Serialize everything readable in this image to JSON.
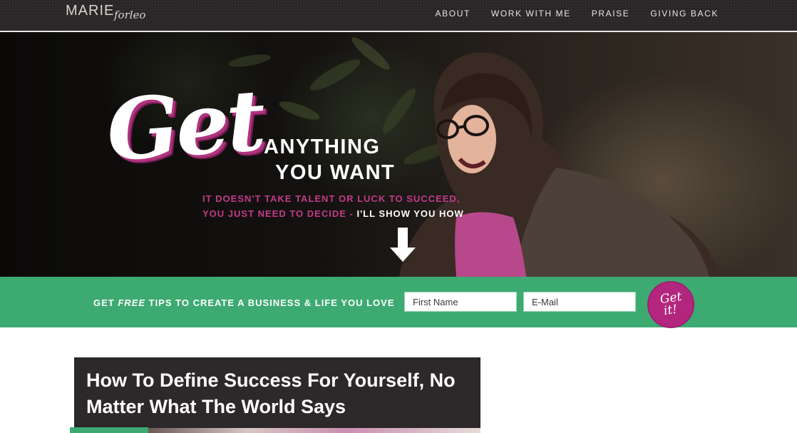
{
  "header": {
    "logo_main": "MARIE",
    "logo_script": "forleo",
    "nav": [
      "ABOUT",
      "WORK WITH ME",
      "PRAISE",
      "GIVING BACK"
    ]
  },
  "hero": {
    "script_word": "Get",
    "line1": "ANYTHING",
    "line2": "YOU WANT",
    "sub1": "IT DOESN'T TAKE TALENT OR LUCK TO SUCCEED,",
    "sub2_pink": "YOU JUST NEED TO DECIDE - ",
    "sub2_white": "I'LL SHOW YOU HOW",
    "arrow_icon": "down-arrow-icon"
  },
  "signup": {
    "text_before": "GET ",
    "text_em": "FREE",
    "text_after": " TIPS TO CREATE A BUSINESS & LIFE YOU LOVE",
    "first_name_placeholder": "First Name",
    "email_placeholder": "E-Mail",
    "button_line1": "Get",
    "button_line2": "it!"
  },
  "article": {
    "title": "How To Define Success For Yourself, No Matter What The World Says"
  },
  "colors": {
    "header_bg": "#2a2627",
    "accent_green": "#3daa72",
    "accent_magenta": "#b3267e",
    "article_bg": "#2d2829"
  }
}
